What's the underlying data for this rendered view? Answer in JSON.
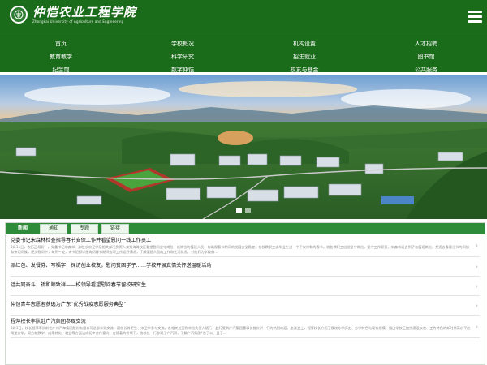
{
  "header": {
    "logo_cn": "仲恺农业工程学院",
    "logo_en": "Zhongkai University of Agriculture and Engineering",
    "menu_icon": "hamburger-menu-icon"
  },
  "nav": {
    "row1": [
      "首页",
      "学校概况",
      "机构设置",
      "人才招聘"
    ],
    "row2": [
      "教育教学",
      "科学研究",
      "招生就业",
      "图书馆"
    ],
    "row3": [
      "纪念馆",
      "数字仲恺",
      "校友与基金",
      "公共服务"
    ]
  },
  "banner": {
    "slides": 2,
    "active_index": 0,
    "colors": {
      "sky_top": "#7aa8d8",
      "sky_bottom": "#f4c98a",
      "hills": "#2f6b2a",
      "buildings": "#d8dee6",
      "track": "#c0392b",
      "field": "#3f9a3a"
    }
  },
  "news": {
    "tabs": [
      "新闻",
      "通知",
      "专题",
      "链接"
    ],
    "active_tab": 0,
    "items": [
      {
        "title": "党委书记宋森林检查指导春节安保工作并看望慰问一线工作员工",
        "summary": "2月11日，农历正月初一，党委书记宋森林、副校长宋卫学及相关部门负责人来到海珠校区看望慰问坚守岗位一线岗位的值班人员，为确保春节期间的校园安全稳定，在校教职工或毕业生进一个平安祥和的春节，校各教职工自觉坚守岗位，坚守工作职责，宋森林逐去到了各值班岗位，并逐去看春仕节的问候和亲切问候，逐步慰问中，每到一处，宋书记都详细询问春节期间各项工作运行情况，了解值班人员的工作和生活状况，对他们为学校做..."
      },
      {
        "title": "派红包、发餐券、写福字，探访创业校友，慰问贫困学子……学校开展真情关怀送温暖活动",
        "summary": ""
      },
      {
        "title": "话共同奋斗，祈和顺致祥——校领导看望慰问春节留校研究生",
        "summary": ""
      },
      {
        "title": "仲恺青年志愿者获选为广东“优秀战疫志愿服务典型”",
        "summary": ""
      },
      {
        "title": "程萍校长率队赴广汽集团参观交流",
        "summary": "3月1日，校长程萍率队前往广州汽车集团股份有限公司总部参观交流，副校长肖更生、宋卫学参与交流。各相关处室和单位负责人随行，此行受到广汽集团董事长曾庆洪一行的热烈欢迎。座谈会上，程萍校长介绍了我校办学历史、办学特色与现有规模，指出学校正加快建设以农、工为特色的新时代高水平应用型大学。双方就教学、成果转化、就业等方面达成初步合作意向，在随着的带领下，校校长一行参观了广汽研，了解广汽集团“也于公、且于..."
      }
    ]
  }
}
